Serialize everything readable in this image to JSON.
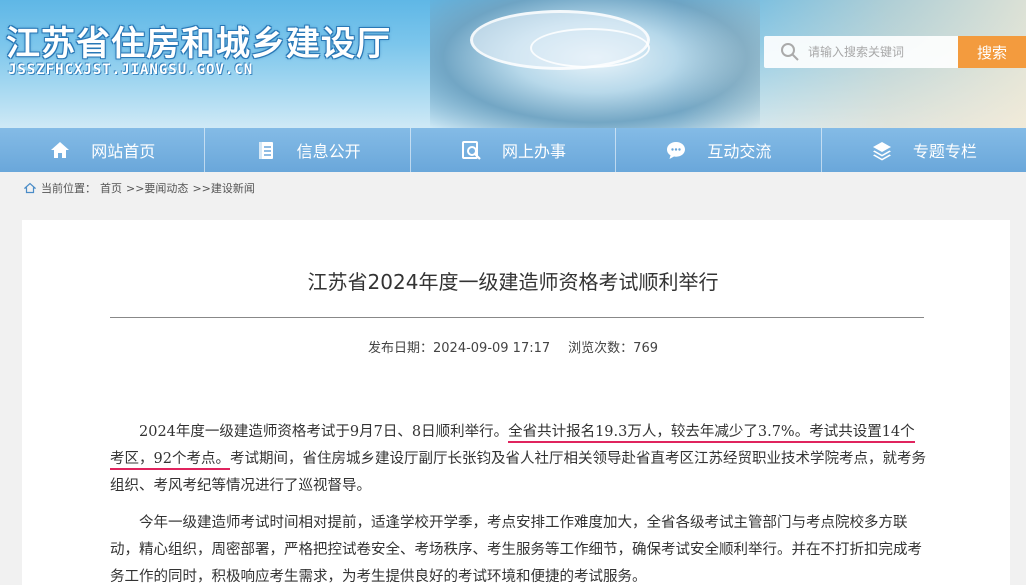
{
  "header": {
    "site_title": "江苏省住房和城乡建设厅",
    "site_url": "JSSZFHCXJST.JIANGSU.GOV.CN",
    "search": {
      "placeholder": "请输入搜索关键词",
      "button_label": "搜索"
    }
  },
  "nav": {
    "items": [
      {
        "label": "网站首页",
        "icon": "home-icon"
      },
      {
        "label": "信息公开",
        "icon": "document-icon"
      },
      {
        "label": "网上办事",
        "icon": "online-service-icon"
      },
      {
        "label": "互动交流",
        "icon": "chat-icon"
      },
      {
        "label": "专题专栏",
        "icon": "layers-icon"
      }
    ]
  },
  "breadcrumb": {
    "prefix": "当前位置：",
    "items": [
      "首页",
      ">>要闻动态",
      ">>建设新闻"
    ]
  },
  "article": {
    "title": "江苏省2024年度一级建造师资格考试顺利举行",
    "publish_label": "发布日期：",
    "publish_date": "2024-09-09 17:17",
    "views_label": "浏览次数：",
    "views": "769",
    "p1_a": "2024年度一级建造师资格考试于9月7日、8日顺利举行。",
    "p1_hl1": "全省共计报名19.3万人，较去年减少了3.7%。考试共设置14个考区，92个考点。",
    "p1_b": "考试期间，省住房城乡建设厅副厅长张钧及省人社厅相关领导赴省直考区江苏经贸职业技术学院考点，就考务组织、考风考纪等情况进行了巡视督导。",
    "p2": "今年一级建造师考试时间相对提前，适逢学校开学季，考点安排工作难度加大，全省各级考试主管部门与考点院校多方联动，精心组织，周密部署，严格把控试卷安全、考场秩序、考生服务等工作细节，确保考试安全顺利举行。并在不打折扣完成考务工作的同时，积极响应考生需求，为考生提供良好的考试环境和便捷的考试服务。"
  },
  "colors": {
    "nav_bg": "#6aa7da",
    "search_button": "#f39b3e",
    "highlight_underline": "#e0245e"
  }
}
